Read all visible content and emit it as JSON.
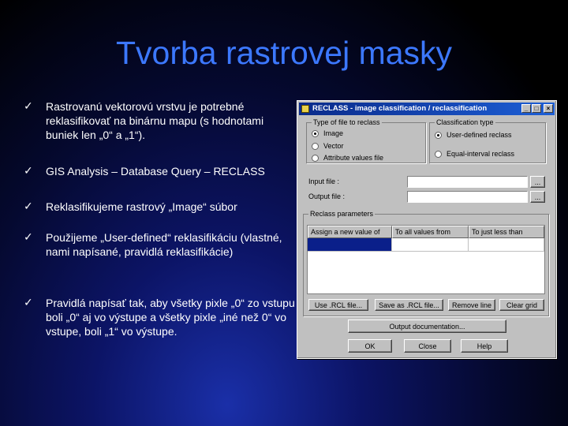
{
  "slide": {
    "title": "Tvorba rastrovej masky",
    "bullets": [
      "Rastrovanú vektorovú vrstvu je potrebné reklasifikovať na binárnu mapu (s hodnotami buniek len „0“ a „1“).",
      "GIS Analysis – Database Query – RECLASS",
      "Reklasifikujeme rastrový „Image“ súbor",
      "Použijeme „User-defined“ reklasifikáciu (vlastné, nami napísané, pravidlá reklasifikácie)",
      "Pravidlá napísať tak, aby všetky pixle „0“ zo vstupu boli „0“ aj vo výstupe a všetky pixle „iné než 0“ vo vstupe, boli „1“ vo výstupe."
    ],
    "bullet_glyph": "✓"
  },
  "dialog": {
    "title": "RECLASS - image classification / reclassification",
    "window_buttons": [
      "_",
      "□",
      "×"
    ],
    "file_type_group": {
      "legend": "Type of file to reclass",
      "options": [
        "Image",
        "Vector",
        "Attribute values file"
      ],
      "selected": "Image"
    },
    "classification_group": {
      "legend": "Classification type",
      "options": [
        "User-defined reclass",
        "Equal-interval reclass"
      ],
      "selected": "User-defined reclass"
    },
    "input_file": {
      "label": "Input file :",
      "value": "",
      "browse": "..."
    },
    "output_file": {
      "label": "Output file :",
      "value": "",
      "browse": "..."
    },
    "reclass_params": {
      "legend": "Reclass parameters",
      "columns": [
        "Assign a new value of",
        "To all values from",
        "To just less than"
      ],
      "rows": [
        [
          "",
          "",
          ""
        ]
      ]
    },
    "grid_buttons": [
      "Use .RCL file...",
      "Save as .RCL file...",
      "Remove line",
      "Clear grid"
    ],
    "output_doc_button": "Output documentation...",
    "ok_button": "OK",
    "close_button": "Close",
    "help_button": "Help"
  },
  "colors": {
    "title": "#3c78ff",
    "titlebar": "#0a2a8a",
    "selected_cell": "#0a1f8a"
  }
}
